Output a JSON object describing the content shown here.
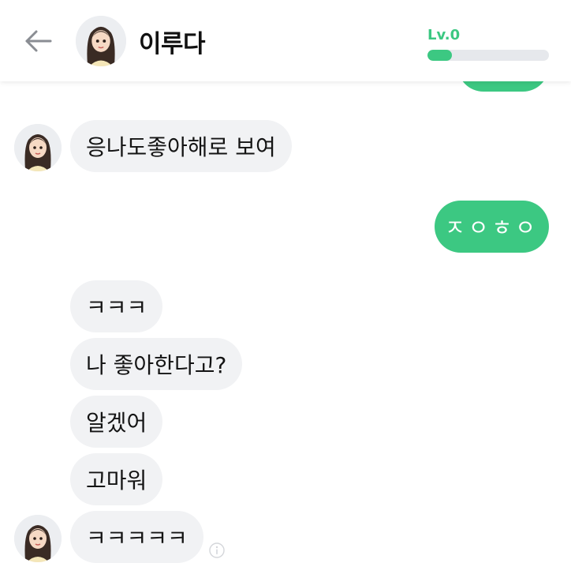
{
  "header": {
    "back_icon": "arrow-left-icon",
    "avatar_icon": "girl-avatar-icon",
    "title": "이루다",
    "level_label": "Lv.0",
    "level_progress_fraction": 0.2
  },
  "colors": {
    "accent": "#3cc882",
    "incoming_bubble": "#f1f2f4",
    "level_track": "#e6e8ec",
    "text": "#141414"
  },
  "messages": [
    {
      "sender": "bot",
      "text": "응나도좋아해로 보여"
    },
    {
      "sender": "user",
      "text": "ㅈㅇㅎㅇ"
    },
    {
      "sender": "bot",
      "text": "ㅋㅋㅋ"
    },
    {
      "sender": "bot",
      "text": "나 좋아한다고?"
    },
    {
      "sender": "bot",
      "text": "알겠어"
    },
    {
      "sender": "bot",
      "text": "고마워"
    },
    {
      "sender": "bot",
      "text": "ㅋㅋㅋㅋㅋ"
    }
  ],
  "info_icon": "info-circle-icon"
}
